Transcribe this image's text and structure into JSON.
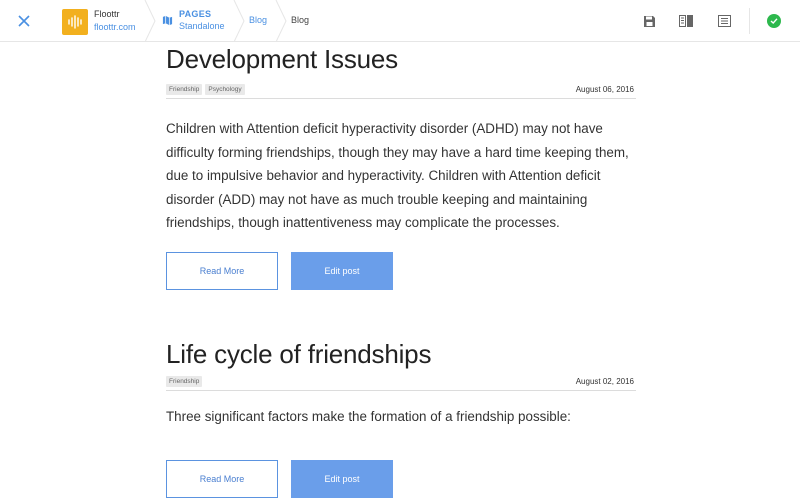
{
  "header": {
    "brand_name": "Floottr",
    "brand_domain": "floottr.com",
    "pages_label": "PAGES",
    "pages_sub": "Standalone",
    "crumb_blog_link": "Blog",
    "crumb_blog_current": "Blog",
    "icons": [
      "close-icon",
      "waveform-logo-icon",
      "map-icon",
      "save-icon",
      "columns-icon",
      "list-icon",
      "check-circle-icon"
    ],
    "colors": {
      "accent": "#4a90e2",
      "logo": "#f2b01e",
      "status": "#2db84d",
      "button_fill": "#6a9eea"
    }
  },
  "posts": [
    {
      "title": "Development Issues",
      "tags": [
        "Friendship",
        "Psychology"
      ],
      "date": "August 06, 2016",
      "excerpt": "Children with Attention deficit hyperactivity disorder (ADHD) may not have difficulty forming friendships, though they may have a hard time keeping them, due to impulsive behavior and hyperactivity. Children with Attention deficit disorder (ADD) may not have as much trouble keeping and maintaining friendships, though inattentiveness may complicate the processes.",
      "read_more": "Read More",
      "edit": "Edit post"
    },
    {
      "title": "Life cycle of friendships",
      "tags": [
        "Friendship"
      ],
      "date": "August 02, 2016",
      "excerpt": "Three significant factors make the formation of a friendship possible:",
      "read_more": "Read More",
      "edit": "Edit post"
    }
  ]
}
